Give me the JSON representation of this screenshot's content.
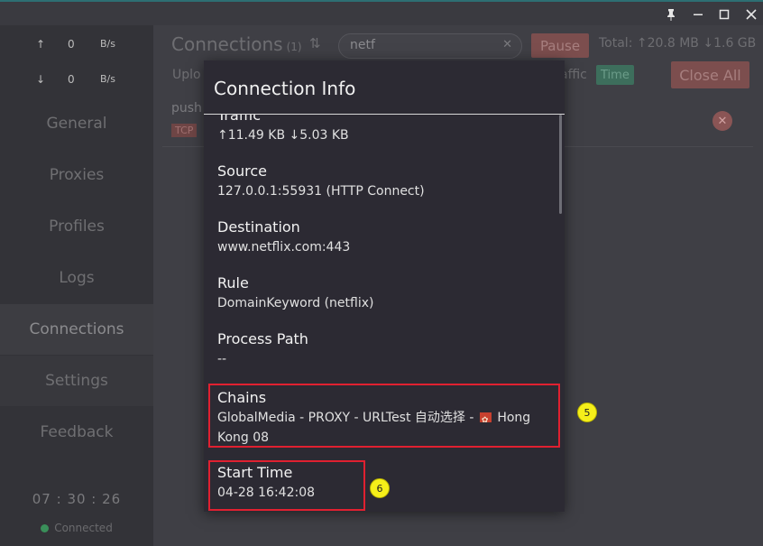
{
  "window": {
    "pin_icon": "pin-icon",
    "minimize_icon": "minimize-icon",
    "maximize_icon": "maximize-icon",
    "close_icon": "close-icon"
  },
  "sidebar": {
    "upload": {
      "arrow": "↑",
      "value": "0",
      "unit": "B/s"
    },
    "download": {
      "arrow": "↓",
      "value": "0",
      "unit": "B/s"
    },
    "nav": [
      "General",
      "Proxies",
      "Profiles",
      "Logs",
      "Connections",
      "Settings",
      "Feedback"
    ],
    "clock": "07 : 30 : 26",
    "status": "Connected"
  },
  "connections": {
    "title": "Connections",
    "count": "(1)",
    "search_value": "netf",
    "pause_label": "Pause",
    "totals": "Total: ↑20.8 MB ↓1.6 GB",
    "sort_upload": "Uplo",
    "sort_traffic": "affic",
    "sort_time": "Time",
    "close_all_label": "Close All",
    "row": {
      "host": "push",
      "tag": "TCP"
    }
  },
  "modal": {
    "title": "Connection Info",
    "fields": [
      {
        "label": "Traffic",
        "value": "↑11.49 KB ↓5.03 KB"
      },
      {
        "label": "Source",
        "value": "127.0.0.1:55931 (HTTP Connect)"
      },
      {
        "label": "Destination",
        "value": "www.netflix.com:443"
      },
      {
        "label": "Rule",
        "value": "DomainKeyword (netflix)"
      },
      {
        "label": "Process Path",
        "value": "--"
      },
      {
        "label": "Chains",
        "value_before_flag": "GlobalMedia - PROXY - URLTest 自动选择 -",
        "value_after_flag": "Hong",
        "value_line2": "Kong 08"
      },
      {
        "label": "Start Time",
        "value": "04-28 16:42:08"
      }
    ]
  },
  "annotations": {
    "marker_5": "5",
    "marker_6": "6",
    "highlight_color": "#e02030",
    "marker_color": "#f5ef1a"
  }
}
